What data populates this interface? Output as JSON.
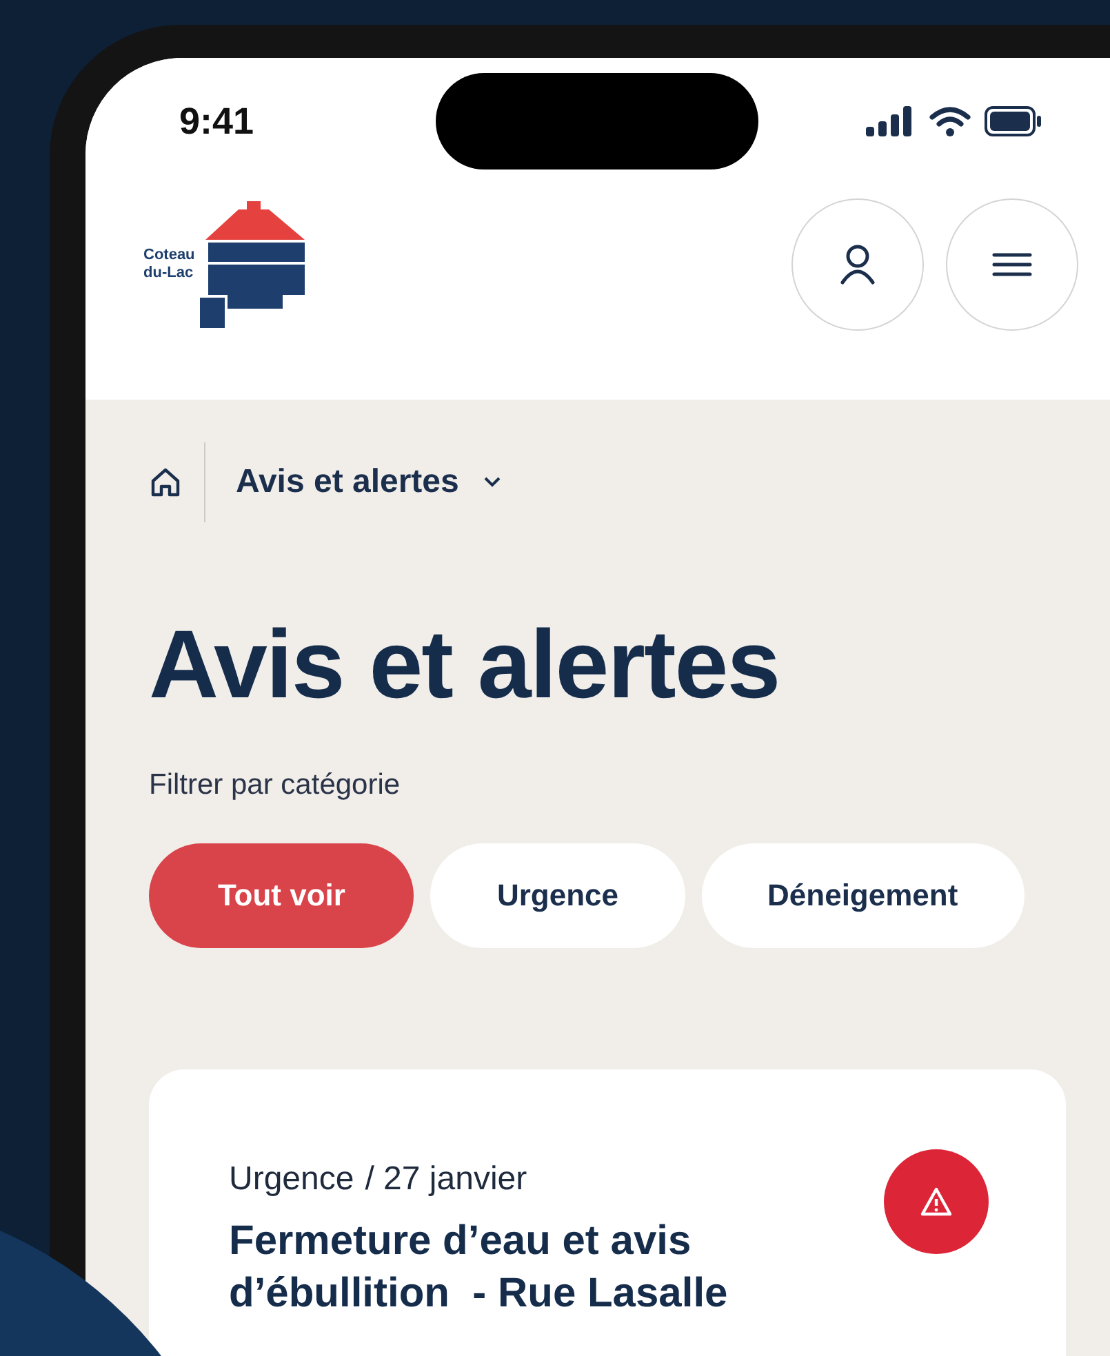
{
  "status_bar": {
    "time": "9:41"
  },
  "logo": {
    "lines": [
      "Coteau",
      "du-Lac"
    ]
  },
  "breadcrumb": {
    "current": "Avis et alertes"
  },
  "page_title": "Avis et alertes",
  "filter_label": "Filtrer par catégorie",
  "filters": [
    {
      "label": "Tout voir",
      "selected": true
    },
    {
      "label": "Urgence",
      "selected": false
    },
    {
      "label": "Déneigement",
      "selected": false
    }
  ],
  "alerts": [
    {
      "category": "Urgence",
      "date": "/ 27 janvier",
      "title": "Fermeture d’eau et avis d’ébullition  - Rue Lasalle"
    }
  ]
}
